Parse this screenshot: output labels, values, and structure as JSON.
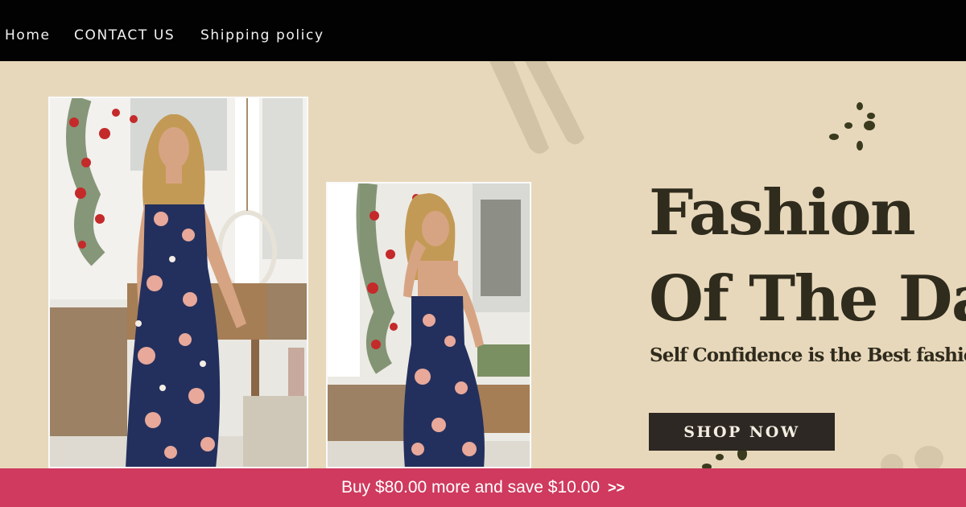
{
  "nav": {
    "items": [
      {
        "label": "Home"
      },
      {
        "label": "CONTACT US"
      },
      {
        "label": "Shipping policy"
      }
    ]
  },
  "hero": {
    "headline_line1": "Fashion",
    "headline_line2": "Of The Day",
    "subheadline": "Self Confidence is the Best fashion",
    "cta_label": "SHOP NOW"
  },
  "promo": {
    "text": "Buy $80.00 more and save $10.00",
    "arrow": ">>"
  },
  "colors": {
    "nav_bg": "#020202",
    "hero_bg": "#e8d8bb",
    "headline": "#2f2b1d",
    "button_bg": "#2d2823",
    "promo_bg": "#cf3a5e",
    "dress": "#23305e"
  },
  "images": [
    {
      "name": "model-front-photo"
    },
    {
      "name": "model-back-photo"
    }
  ]
}
